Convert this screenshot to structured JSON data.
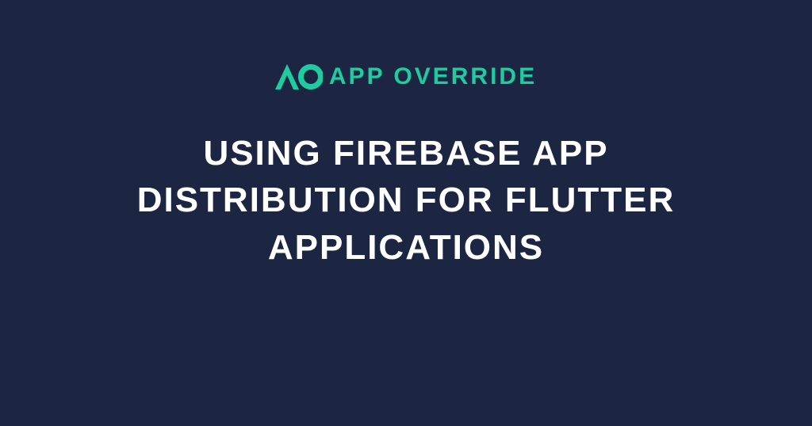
{
  "brand": {
    "name": "APP OVERRIDE",
    "accent_color": "#1fcba1",
    "background_color": "#1c2541",
    "text_color": "#ffffff"
  },
  "headline": "USING FIREBASE APP DISTRIBUTION FOR FLUTTER APPLICATIONS"
}
